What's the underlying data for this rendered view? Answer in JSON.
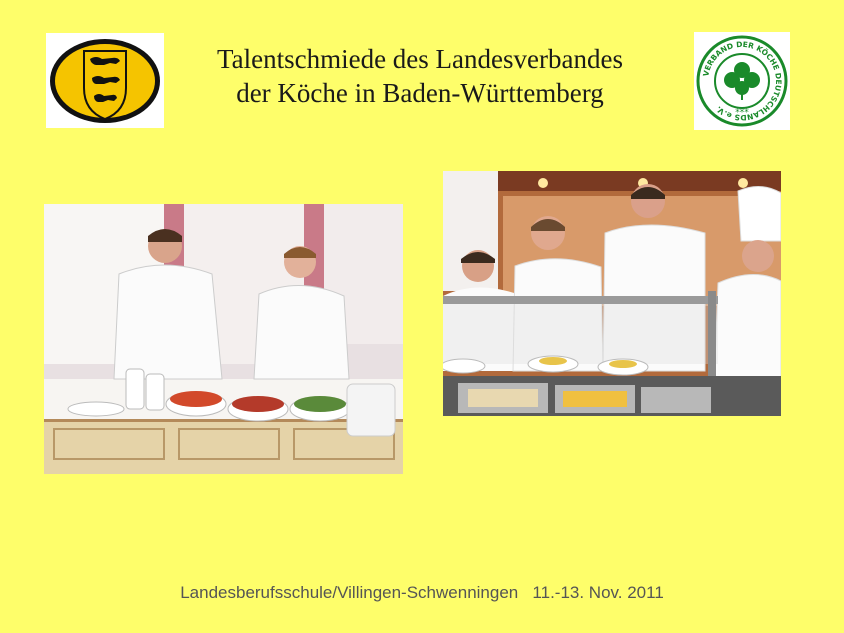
{
  "header": {
    "title_line1": "Talentschmiede des Landesverbandes",
    "title_line2": "der Köche in Baden-Württemberg"
  },
  "logos": {
    "left": {
      "icon": "baden-wuerttemberg-coat-of-arms-icon",
      "colors": [
        "#f5c400",
        "#111111"
      ]
    },
    "right": {
      "icon": "cloverleaf-seal-icon",
      "ring_text": "VERBAND DER KÖCHE DEUTSCHLANDS e.V.",
      "stars": "***",
      "colors": [
        "#1a8a2a",
        "#ffffff"
      ]
    }
  },
  "photos": {
    "left": {
      "subject": "buffet-serving-photo"
    },
    "right": {
      "subject": "hot-counter-serving-photo"
    }
  },
  "footer": {
    "text": "Landesberufsschule/Villingen-Schwenningen   11.-13. Nov. 2011"
  },
  "colors": {
    "background": "#fefe6a",
    "title": "#1a1a1a",
    "footer": "#555555"
  }
}
